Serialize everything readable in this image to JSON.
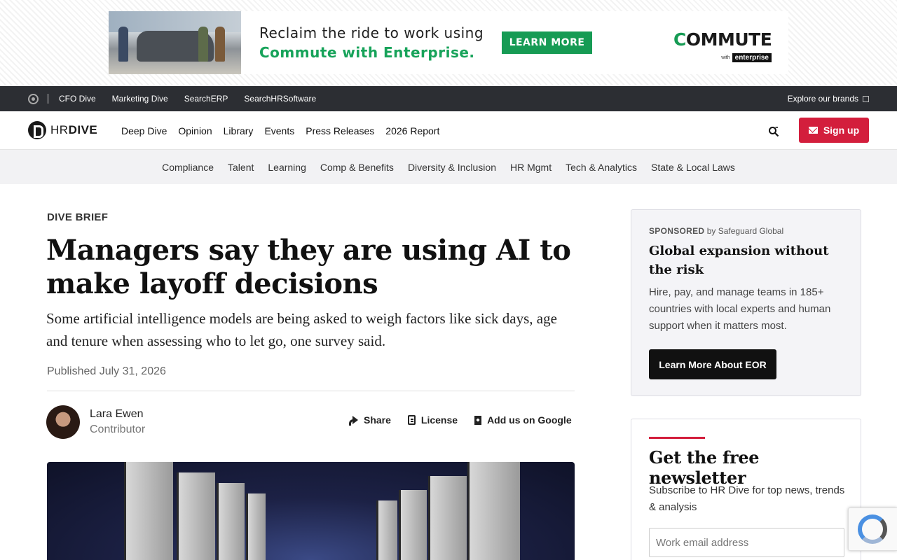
{
  "ad": {
    "line1": "Reclaim the ride to work using",
    "line2": "Commute with Enterprise.",
    "button_label": "LEARN MORE",
    "logo_text_c": "C",
    "logo_text_rest": "OMMUTE",
    "logo_with": "with",
    "logo_brand": "enterprise"
  },
  "brandbar": {
    "links": [
      "CFO Dive",
      "Marketing Dive",
      "SearchERP",
      "SearchHRSoftware"
    ],
    "explore_label": "Explore our brands"
  },
  "header": {
    "logo_hr": "HR",
    "logo_dive": "DIVE",
    "nav": [
      "Deep Dive",
      "Opinion",
      "Library",
      "Events",
      "Press Releases",
      "2026 Report"
    ],
    "signup_label": "Sign up"
  },
  "topics": [
    "Compliance",
    "Talent",
    "Learning",
    "Comp & Benefits",
    "Diversity & Inclusion",
    "HR Mgmt",
    "Tech & Analytics",
    "State & Local Laws"
  ],
  "article": {
    "kicker": "DIVE BRIEF",
    "headline": "Managers say they are using AI to make layoff decisions",
    "dek": "Some artificial intelligence models are being asked to weigh factors like sick days, age and tenure when assessing who to let go, one survey said.",
    "published": "Published July 31, 2026",
    "author_name": "Lara Ewen",
    "author_role": "Contributor",
    "actions": {
      "share": "Share",
      "license": "License",
      "google": "Add us on Google"
    }
  },
  "sponsored": {
    "label": "SPONSORED",
    "by": "by Safeguard Global",
    "title": "Global expansion without the risk",
    "body": "Hire, pay, and manage teams in 185+ countries with local experts and human support when it matters most.",
    "button_label": "Learn More About EOR"
  },
  "newsletter": {
    "title": "Get the free newsletter",
    "body": "Subscribe to HR Dive for top news, trends & analysis",
    "email_placeholder": "Work email address"
  },
  "colors": {
    "brand_red": "#d31e3c",
    "dark_bar": "#2c2e33",
    "ad_green": "#169b54"
  }
}
